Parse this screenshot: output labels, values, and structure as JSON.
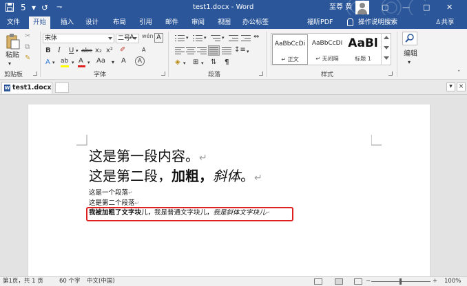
{
  "titlebar": {
    "title": "test1.docx - Word",
    "user": "至尊 黄",
    "save_icon": "save-icon",
    "undo_label": "5",
    "redo_label": "↺",
    "customize_label": "⇁",
    "restore_glyph": "▢",
    "min_glyph": "—",
    "max_glyph": "□",
    "close_glyph": "✕"
  },
  "tabs": [
    {
      "label": "文件"
    },
    {
      "label": "开始"
    },
    {
      "label": "插入"
    },
    {
      "label": "设计"
    },
    {
      "label": "布局"
    },
    {
      "label": "引用"
    },
    {
      "label": "邮件"
    },
    {
      "label": "审阅"
    },
    {
      "label": "视图"
    },
    {
      "label": "办公标签"
    },
    {
      "label": "福昕PDF"
    },
    {
      "label": "操作说明搜索"
    },
    {
      "label": "共享"
    }
  ],
  "ribbon": {
    "clipboard": {
      "paste": "粘贴",
      "label": "剪贴板"
    },
    "font": {
      "name": "宋体",
      "size": "二号",
      "wen": "wén",
      "grow": "A",
      "shrink": "A",
      "case": "Aa",
      "bold": "B",
      "italic": "I",
      "underline": "U",
      "strike": "abc",
      "sub": "x₂",
      "sup": "x²",
      "effects": "A",
      "highlight": "ab",
      "fontcolor": "A",
      "a_big": "A",
      "a_circle": "A",
      "label": "字体"
    },
    "paragraph": {
      "label": "段落"
    },
    "styles": {
      "items": [
        {
          "sample": "AaBbCcDi",
          "name": "↵ 正文"
        },
        {
          "sample": "AaBbCcDi",
          "name": "↵ 无间隔"
        },
        {
          "sample": "AaBl",
          "name": "标题 1"
        }
      ],
      "label": "样式"
    },
    "editing": {
      "label": "编辑"
    }
  },
  "docstrip": {
    "tab_name": "test1.docx",
    "word_glyph": "W",
    "dropdown_glyph": "▾",
    "close_glyph": "×"
  },
  "document": {
    "p1": "这是第一段内容。",
    "p2_a": "这是第二段，",
    "p2_b": "加粗，",
    "p2_c": "斜体",
    "p2_d": "。",
    "return_mark": "↵",
    "line3": "这是一个段落",
    "line4": "这是第二个段落",
    "line5_bold": "我被加粗了文字块",
    "line5_bold2": "儿",
    "line5_normal": "，我是普通文字块儿，",
    "line5_italic": "我是斜体文字块儿"
  },
  "statusbar": {
    "page": "第1页，共 1 页",
    "words": "60 个字",
    "lang": "中文(中国)",
    "zoom_minus": "−",
    "zoom_plus": "+",
    "zoom": "100%"
  },
  "colors": {
    "word_blue": "#2b579a",
    "highlight_red": "#e02020"
  }
}
